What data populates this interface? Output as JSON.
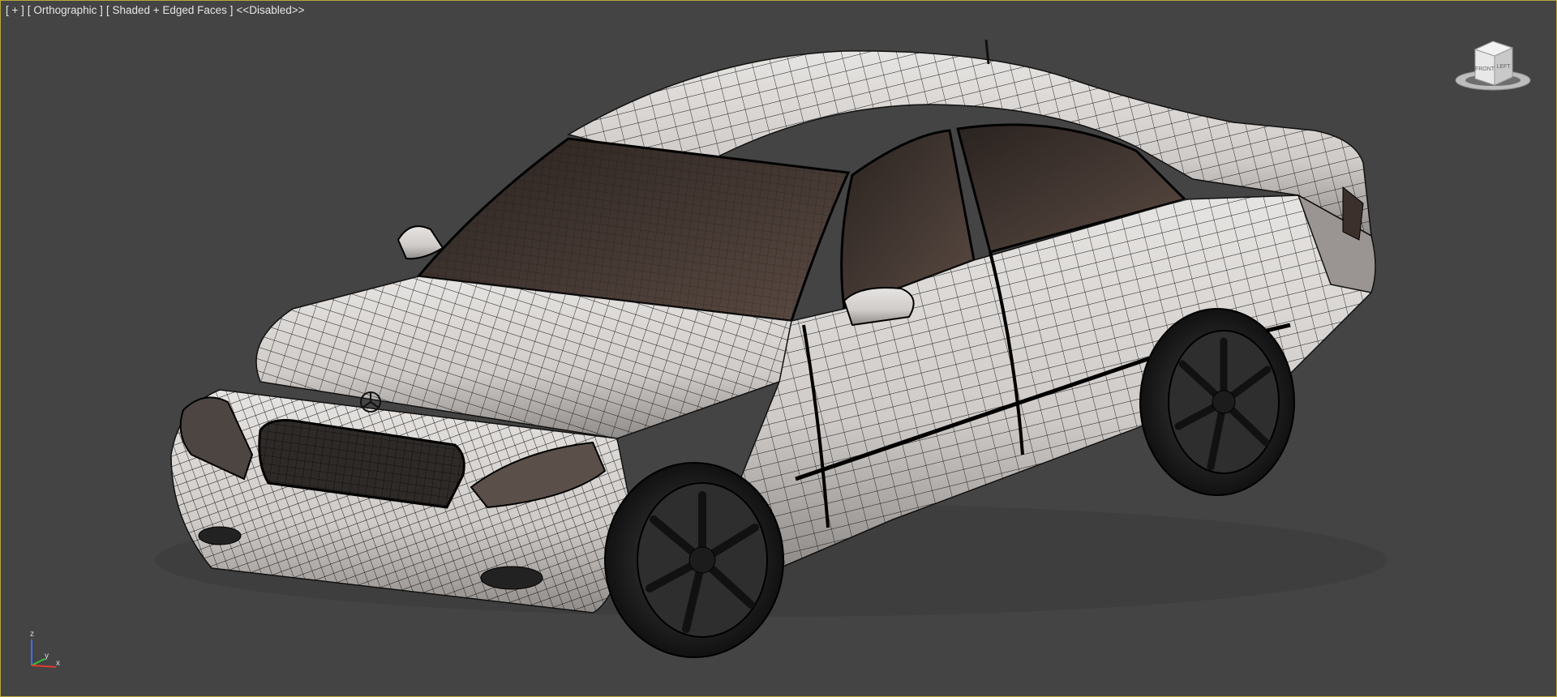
{
  "viewport": {
    "label_segments": [
      {
        "text": "[ + ]",
        "name": "viewport-menu-plus"
      },
      {
        "text": "[ Orthographic ]",
        "name": "viewport-view-label"
      },
      {
        "text": "[ Shaded + Edged Faces ]",
        "name": "viewport-shading-label"
      },
      {
        "text": "<<Disabled>>",
        "name": "viewport-disabled-label"
      }
    ],
    "background_color": "#444444",
    "border_color": "#b9a53a"
  },
  "viewcube": {
    "face_front": "FRONT",
    "face_side": "LEFT"
  },
  "axis_tripod": {
    "z": "z",
    "y": "y",
    "x": "x"
  },
  "scene": {
    "object": "sedan-car-wireframe-model",
    "body_color": "#d9d6d4",
    "edge_color": "#1a1a1a",
    "interior_color": "#3a302b"
  }
}
